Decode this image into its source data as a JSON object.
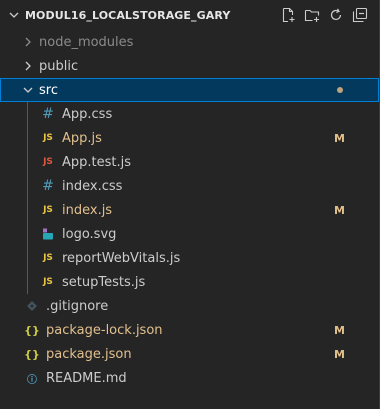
{
  "explorer": {
    "title": "MODUL16_LOCALSTORAGE_GARY",
    "actions": [
      {
        "name": "new-file-icon"
      },
      {
        "name": "new-folder-icon"
      },
      {
        "name": "refresh-icon"
      },
      {
        "name": "collapse-all-icon"
      }
    ]
  },
  "tree": {
    "node_modules": {
      "label": "node_modules"
    },
    "public": {
      "label": "public"
    },
    "src": {
      "label": "src"
    },
    "app_css": {
      "label": "App.css"
    },
    "app_js": {
      "label": "App.js",
      "badge": "M"
    },
    "app_test_js": {
      "label": "App.test.js"
    },
    "index_css": {
      "label": "index.css"
    },
    "index_js": {
      "label": "index.js",
      "badge": "M"
    },
    "logo_svg": {
      "label": "logo.svg"
    },
    "report_web_vitals": {
      "label": "reportWebVitals.js"
    },
    "setup_tests": {
      "label": "setupTests.js"
    },
    "gitignore": {
      "label": ".gitignore"
    },
    "package_lock": {
      "label": "package-lock.json",
      "badge": "M"
    },
    "package_json": {
      "label": "package.json",
      "badge": "M"
    },
    "readme": {
      "label": "README.md"
    }
  },
  "icon_text": {
    "js": "JS",
    "hash": "#",
    "braces": "{}",
    "info": "ⓘ"
  },
  "colors": {
    "background": "#252526",
    "selection": "#04395e",
    "selection_border": "#007fd4",
    "modified": "#e2c08d",
    "js_icon": "#e8c441",
    "test_icon": "#e0573f",
    "css_icon": "#519aba",
    "json_icon": "#cbcb41"
  }
}
